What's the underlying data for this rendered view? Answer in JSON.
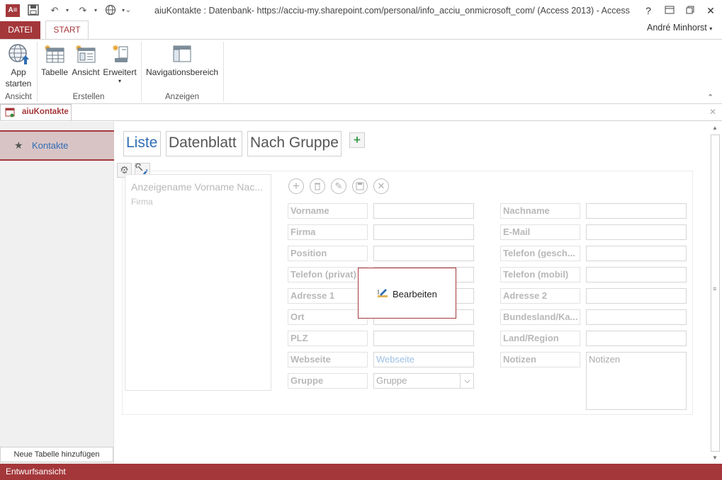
{
  "window": {
    "title": "aiuKontakte : Datenbank- https://acciu-my.sharepoint.com/personal/info_acciu_onmicrosoft_com/ (Access 2013) - Access",
    "help": "?",
    "minimize": "─",
    "restore": "❐",
    "close": "✕"
  },
  "ribbon": {
    "tabs": [
      "DATEI",
      "START"
    ],
    "user": "André Minhorst",
    "groups": {
      "ansicht": {
        "label": "Ansicht",
        "app_line1": "App",
        "app_line2": "starten"
      },
      "erstellen": {
        "label": "Erstellen",
        "tabelle": "Tabelle",
        "ansicht": "Ansicht",
        "erweitert": "Erweitert"
      },
      "anzeigen": {
        "label": "Anzeigen",
        "nav": "Navigationsbereich"
      }
    }
  },
  "doc_tab": {
    "label": "aiuKontakte"
  },
  "nav": {
    "item": "Kontakte",
    "add_table": "Neue Tabelle hinzufügen"
  },
  "views": {
    "tabs": [
      "Liste",
      "Datenblatt",
      "Nach Gruppe"
    ],
    "add": "+"
  },
  "list": {
    "title": "Anzeigename Vorname Nac...",
    "sub": "Firma"
  },
  "form": {
    "left_labels": [
      "Vorname",
      "Firma",
      "Position",
      "Telefon (privat)",
      "Adresse 1",
      "Ort",
      "PLZ",
      "Webseite",
      "Gruppe"
    ],
    "right_labels": [
      "Nachname",
      "E-Mail",
      "Telefon (gesch...",
      "Telefon (mobil)",
      "Adresse 2",
      "Bundesland/Ka...",
      "Land/Region",
      "Notizen"
    ],
    "webseite_placeholder": "Webseite",
    "gruppe_placeholder": "Gruppe",
    "notizen_placeholder": "Notizen"
  },
  "popup": {
    "label": "Bearbeiten"
  },
  "status": {
    "text": "Entwurfsansicht"
  },
  "colors": {
    "accent": "#a4373a",
    "link": "#2f6db5",
    "nav_selected": "#d8c4c5"
  }
}
